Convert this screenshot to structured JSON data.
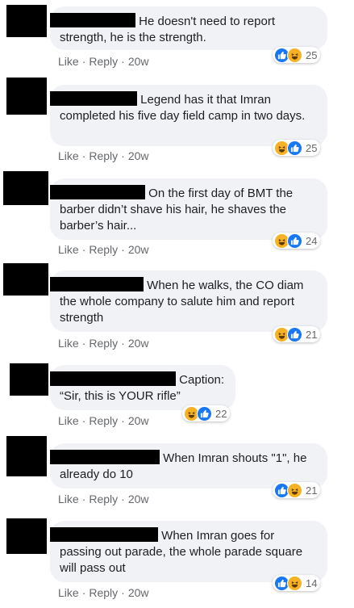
{
  "comments": [
    {
      "text": "He doesn't need to report strength, he is the strength.",
      "reactions": [
        "like",
        "haha"
      ],
      "count": "25"
    },
    {
      "text": "Legend has it that Imran completed his five day field camp in two days.",
      "reactions": [
        "haha",
        "like"
      ],
      "count": "25"
    },
    {
      "text": "On the first day of BMT the barber didn’t shave his hair, he shaves the barber’s hair...",
      "reactions": [
        "haha",
        "like"
      ],
      "count": "24"
    },
    {
      "text": "When he walks, the CO diam the whole company to salute him and report strength",
      "reactions": [
        "haha",
        "like"
      ],
      "count": "21"
    },
    {
      "text": "Caption: “Sir, this is YOUR rifle”",
      "reactions": [
        "haha",
        "like"
      ],
      "count": "22"
    },
    {
      "text": "When Imran shouts \"1\", he already do 10",
      "reactions": [
        "like",
        "haha"
      ],
      "count": "21"
    },
    {
      "text": "When Imran goes for passing out parade, the whole parade square will pass out",
      "reactions": [
        "like",
        "haha"
      ],
      "count": "14"
    }
  ],
  "actions": {
    "like": "Like",
    "reply": "Reply",
    "time": "20w",
    "dot": "·"
  },
  "colors": {
    "bubble": "#f0f2f5",
    "meta": "#65676b",
    "like": "#1877f2",
    "haha": "#f7b125"
  }
}
